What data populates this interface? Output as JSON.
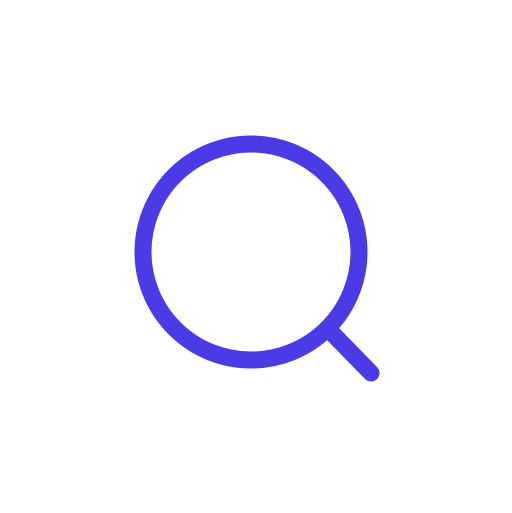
{
  "icon": {
    "name": "search-icon",
    "color": "#4B3BE6"
  }
}
